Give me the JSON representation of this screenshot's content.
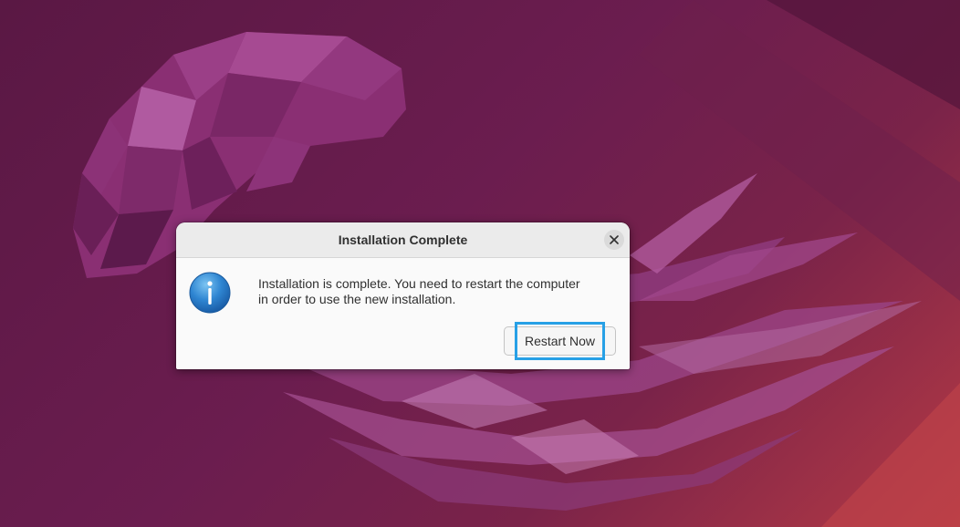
{
  "desktop": {
    "wallpaper_colors": [
      "#5a1844",
      "#7a2349",
      "#b53a45"
    ]
  },
  "dialog": {
    "title": "Installation Complete",
    "close_icon": "close-icon",
    "info_icon": "info-icon",
    "message_line1": "Installation is complete. You need to restart the computer",
    "message_line2": "in order to use the new installation.",
    "restart_button_label": "Restart Now",
    "accent_color": "#27a0e6"
  }
}
